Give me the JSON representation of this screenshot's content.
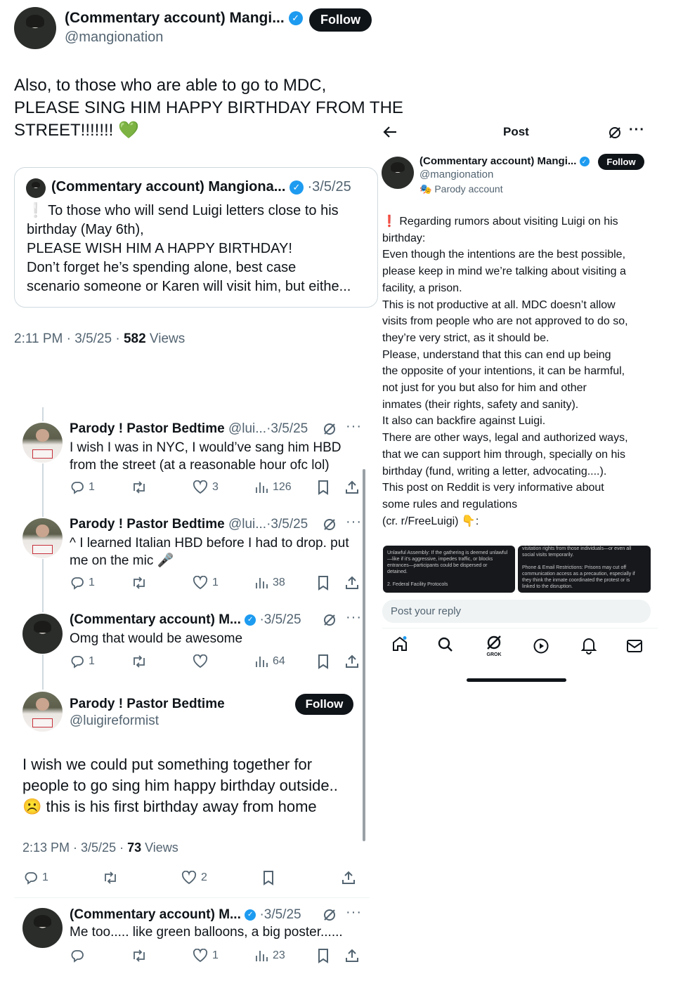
{
  "main_tweet": {
    "name": "(Commentary account) Mangi...",
    "handle": "@mangionation",
    "follow_label": "Follow",
    "text_lines": [
      "Also, to those who are able to go to MDC,",
      "PLEASE SING HIM HAPPY BIRTHDAY FROM THE",
      "STREET!!!!!!! 💚"
    ],
    "quoted": {
      "name": "(Commentary account) Mangiona...",
      "date": "·3/5/25",
      "lines": [
        "❕ To those who will send Luigi letters close to his",
        "birthday (May 6th),",
        "PLEASE WISH HIM A HAPPY BIRTHDAY!",
        "Don’t forget he’s spending alone, best case",
        "scenario someone or Karen will visit him, but eithe..."
      ]
    },
    "meta_time": "2:11 PM · 3/5/25 · ",
    "meta_views_count": "582",
    "meta_views_label": " Views"
  },
  "replies": [
    {
      "name": "Parody ! Pastor Bedtime",
      "handle": "@lui...",
      "date": "·3/5/25",
      "lines": [
        "I wish I was in NYC, I would’ve sang him HBD",
        "from the street (at a reasonable hour ofc lol)"
      ],
      "replies": "1",
      "reposts": "",
      "likes": "3",
      "views": "126"
    },
    {
      "name": "Parody ! Pastor Bedtime",
      "handle": "@lui...",
      "date": "·3/5/25",
      "lines": [
        "^ I learned Italian HBD before I had to drop. put",
        "me on the mic 🎤"
      ],
      "replies": "1",
      "reposts": "",
      "likes": "1",
      "views": "38"
    },
    {
      "name": "(Commentary account) M...",
      "handle": "",
      "date": "·3/5/25",
      "lines": [
        "Omg that would be awesome"
      ],
      "replies": "1",
      "reposts": "",
      "likes": "",
      "views": "64"
    }
  ],
  "focus_tweet": {
    "name": "Parody ! Pastor Bedtime",
    "handle": "@luigireformist",
    "follow_label": "Follow",
    "lines": [
      "I wish we could put something together for",
      "people to go sing him happy birthday outside..",
      "☹️ this is his first birthday away from home"
    ],
    "meta_time": "2:13 PM · 3/5/25 · ",
    "meta_views_count": "73",
    "meta_views_label": " Views",
    "replies": "1",
    "reposts": "",
    "likes": "2"
  },
  "last_reply": {
    "name": "(Commentary account) M...",
    "date": "·3/5/25",
    "lines": [
      "Me too..... like green balloons, a big poster......"
    ],
    "replies": "",
    "reposts": "",
    "likes": "1",
    "views": "23"
  },
  "right_post": {
    "header_title": "Post",
    "name": "(Commentary account) Mangi...",
    "handle": "@mangionation",
    "parody_label": "Parody account",
    "follow_label": "Follow",
    "lines": [
      "❗ Regarding rumors about visiting Luigi on his",
      "birthday:",
      "Even though the intentions are the best possible,",
      "please keep in mind we’re talking about visiting a",
      "facility, a prison.",
      "This is not productive at all. MDC doesn’t allow",
      "visits from people who are not approved to do so,",
      "they’re very strict, as it should be.",
      "Please, understand that this can end up being",
      "the opposite of your intentions, it can be harmful,",
      "not just for you but also for him and other",
      "inmates (their rights, safety and sanity).",
      "It also can backfire against Luigi.",
      "There are other ways, legal and authorized ways,",
      "that we can support him through, specially on his",
      "birthday (fund, writing a letter, advocating....).",
      "This post on Reddit is very informative about",
      "some rules and regulations",
      "(cr. r/FreeLuigi) 👇:"
    ],
    "image_left_lines": [
      "Unlawful Assembly: If the gathering is deemed unlawful",
      "—like if it's aggressive, impedes traffic, or blocks",
      "entrances—participants could be dispersed or",
      "detained.",
      "",
      "2. Federal Facility Protocols"
    ],
    "image_right_lines": [
      "visitation rights from those individuals—or even all",
      "social visits temporarily.",
      "",
      "Phone & Email Restrictions: Prisons may cut off",
      "communication access as a precaution, especially if",
      "they think the inmate coordinated the protest or is",
      "linked to the disruption."
    ],
    "reply_placeholder": "Post your reply",
    "grok_label": "GROK"
  },
  "icons": [
    "verified-icon",
    "grok-icon",
    "more-icon",
    "reply-icon",
    "repost-icon",
    "like-icon",
    "views-icon",
    "bookmark-icon",
    "share-icon",
    "back-icon",
    "home-icon",
    "search-icon",
    "video-icon",
    "bell-icon",
    "mail-icon",
    "parody-mask-icon"
  ],
  "colors": {
    "verified": "#1d9bf0",
    "text": "#0f1419",
    "muted": "#536471",
    "button": "#0f1419"
  }
}
